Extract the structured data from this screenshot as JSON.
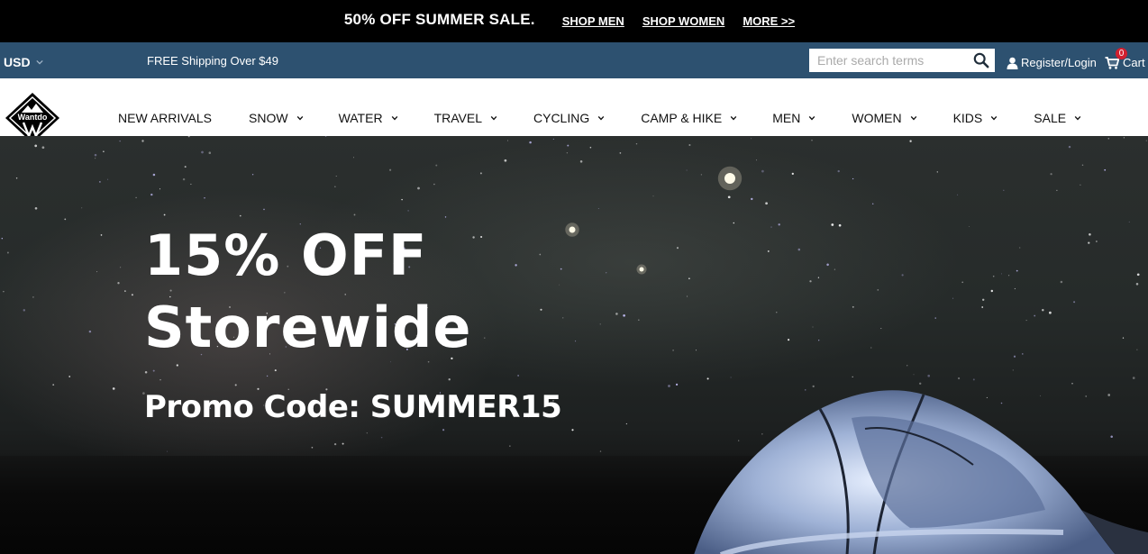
{
  "promo_bar": {
    "headline": "50% OFF SUMMER SALE.",
    "links": [
      "SHOP MEN",
      "SHOP WOMEN",
      "MORE >>"
    ]
  },
  "utility_bar": {
    "currency": "USD",
    "shipping": "FREE Shipping Over $49",
    "search_placeholder": "Enter search terms",
    "login": "Register/Login",
    "cart_label": "Cart",
    "cart_count": "0",
    "background": "#2d5170"
  },
  "nav": {
    "logo_text": "Wantdo",
    "items": [
      {
        "label": "NEW ARRIVALS",
        "dropdown": false
      },
      {
        "label": "SNOW",
        "dropdown": true
      },
      {
        "label": "WATER",
        "dropdown": true
      },
      {
        "label": "TRAVEL",
        "dropdown": true
      },
      {
        "label": "CYCLING",
        "dropdown": true
      },
      {
        "label": "CAMP & HIKE",
        "dropdown": true
      },
      {
        "label": "MEN",
        "dropdown": true
      },
      {
        "label": "WOMEN",
        "dropdown": true
      },
      {
        "label": "KIDS",
        "dropdown": true
      },
      {
        "label": "SALE",
        "dropdown": true
      }
    ]
  },
  "hero": {
    "title_line1": "15% OFF",
    "title_line2": "Storewide",
    "promo_code": "Promo Code: SUMMER15"
  },
  "icons": {
    "search": "search-icon",
    "user": "user-icon",
    "cart": "cart-icon",
    "chevron": "chevron-down-icon"
  }
}
